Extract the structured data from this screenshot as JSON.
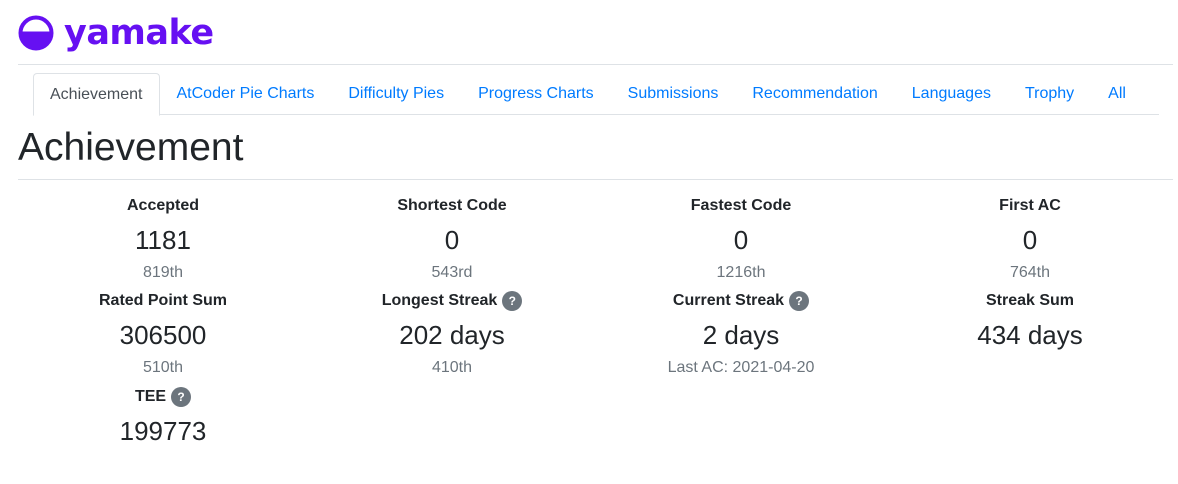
{
  "header": {
    "user_name": "yamake"
  },
  "tabs": [
    {
      "label": "Achievement",
      "active": true
    },
    {
      "label": "AtCoder Pie Charts"
    },
    {
      "label": "Difficulty Pies"
    },
    {
      "label": "Progress Charts"
    },
    {
      "label": "Submissions"
    },
    {
      "label": "Recommendation"
    },
    {
      "label": "Languages"
    },
    {
      "label": "Trophy"
    },
    {
      "label": "All"
    }
  ],
  "page_title": "Achievement",
  "stats": {
    "accepted": {
      "label": "Accepted",
      "value": "1181",
      "rank": "819th"
    },
    "shortest_code": {
      "label": "Shortest Code",
      "value": "0",
      "rank": "543rd"
    },
    "fastest_code": {
      "label": "Fastest Code",
      "value": "0",
      "rank": "1216th"
    },
    "first_ac": {
      "label": "First AC",
      "value": "0",
      "rank": "764th"
    },
    "rated_point_sum": {
      "label": "Rated Point Sum",
      "value": "306500",
      "rank": "510th"
    },
    "longest_streak": {
      "label": "Longest Streak",
      "value": "202 days",
      "rank": "410th"
    },
    "current_streak": {
      "label": "Current Streak",
      "value": "2 days",
      "last_ac": "Last AC: 2021-04-20"
    },
    "streak_sum": {
      "label": "Streak Sum",
      "value": "434 days"
    },
    "tee": {
      "label": "TEE",
      "value": "199773"
    }
  },
  "help_icon_glyph": "?",
  "colors": {
    "brand": "#6610f2",
    "link": "#007bff",
    "muted": "#6c757d",
    "border": "#dee2e6"
  }
}
